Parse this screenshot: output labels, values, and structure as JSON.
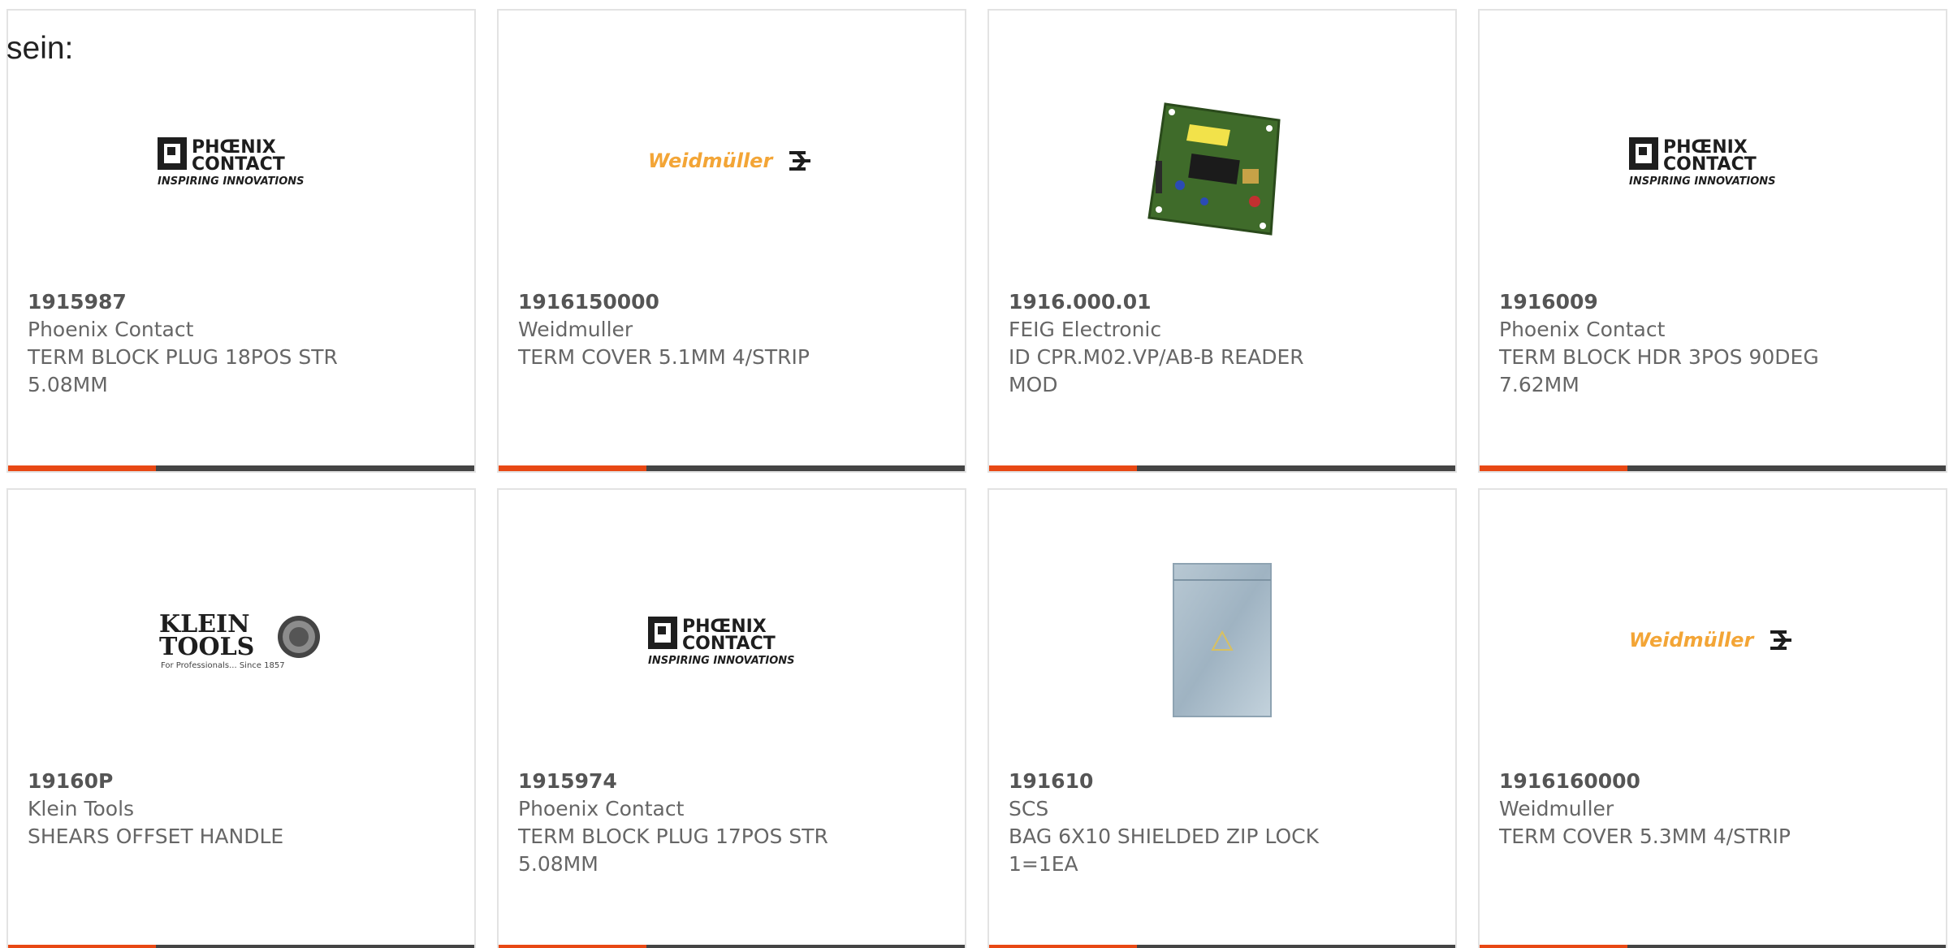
{
  "intro": {
    "text": "sein:"
  },
  "colors": {
    "accent": "#e84814",
    "bar": "#444444",
    "card_border": "#e3e3e3",
    "phoenix_text": "#1e1e1e",
    "weidmuller_orange": "#f3a536"
  },
  "cards": [
    {
      "image": "phoenix-contact-logo",
      "logo_line1": "PHŒNIX",
      "logo_line2": "CONTACT",
      "logo_tagline": "INSPIRING INNOVATIONS",
      "part_number": "1915987",
      "manufacturer": "Phoenix Contact",
      "description": "TERM BLOCK PLUG 18POS STR 5.08MM"
    },
    {
      "image": "weidmuller-logo",
      "logo_text": "Weidmüller",
      "part_number": "1916150000",
      "manufacturer": "Weidmuller",
      "description": "TERM COVER 5.1MM 4/STRIP"
    },
    {
      "image": "circuit-board-photo",
      "part_number": "1916.000.01",
      "manufacturer": "FEIG Electronic",
      "description": "ID CPR.M02.VP/AB-B READER MOD"
    },
    {
      "image": "phoenix-contact-logo",
      "logo_line1": "PHŒNIX",
      "logo_line2": "CONTACT",
      "logo_tagline": "INSPIRING INNOVATIONS",
      "part_number": "1916009",
      "manufacturer": "Phoenix Contact",
      "description": "TERM BLOCK HDR 3POS 90DEG 7.62MM"
    },
    {
      "image": "klein-tools-logo",
      "logo_line1": "KLEIN",
      "logo_line2": "TOOLS",
      "logo_tagline": "For Professionals... Since 1857",
      "part_number": "19160P",
      "manufacturer": "Klein Tools",
      "description": "SHEARS OFFSET HANDLE"
    },
    {
      "image": "phoenix-contact-logo",
      "logo_line1": "PHŒNIX",
      "logo_line2": "CONTACT",
      "logo_tagline": "INSPIRING INNOVATIONS",
      "part_number": "1915974",
      "manufacturer": "Phoenix Contact",
      "description": "TERM BLOCK PLUG 17POS STR 5.08MM"
    },
    {
      "image": "shielded-bag-photo",
      "part_number": "191610",
      "manufacturer": "SCS",
      "description": "BAG 6X10 SHIELDED ZIP LOCK 1=1EA"
    },
    {
      "image": "weidmuller-logo",
      "logo_text": "Weidmüller",
      "part_number": "1916160000",
      "manufacturer": "Weidmuller",
      "description": "TERM COVER 5.3MM 4/STRIP"
    }
  ]
}
